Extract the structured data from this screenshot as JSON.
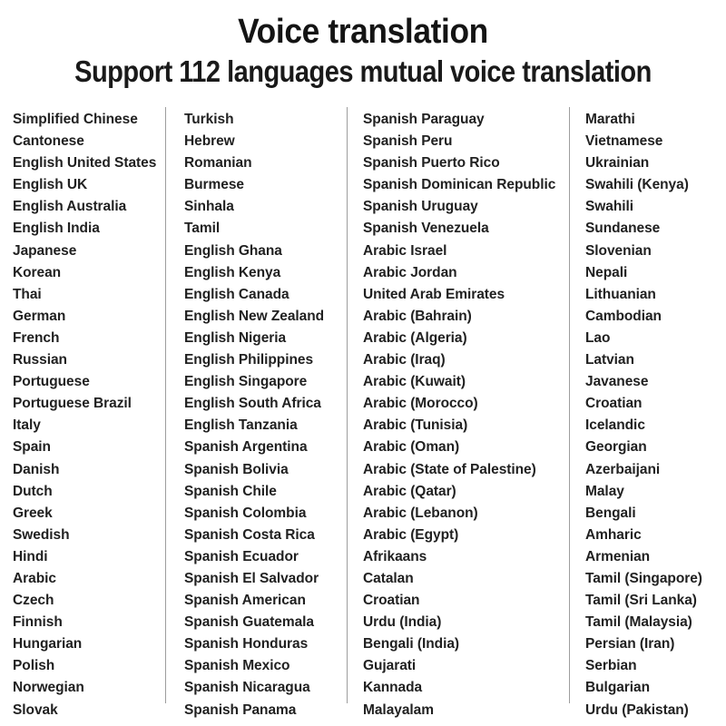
{
  "header": {
    "title": "Voice translation",
    "subtitle": "Support 112 languages mutual voice translation"
  },
  "columns": [
    {
      "index": 0,
      "items": [
        "Simplified Chinese",
        "Cantonese",
        "English United States",
        "English UK",
        "English Australia",
        "English India",
        "Japanese",
        "Korean",
        "Thai",
        "German",
        "French",
        "Russian",
        "Portuguese",
        "Portuguese Brazil",
        "Italy",
        "Spain",
        "Danish",
        "Dutch",
        "Greek",
        "Swedish",
        "Hindi",
        "Arabic",
        "Czech",
        "Finnish",
        "Hungarian",
        "Polish",
        "Norwegian",
        "Slovak"
      ]
    },
    {
      "index": 1,
      "items": [
        "Turkish",
        "Hebrew",
        "Romanian",
        "Burmese",
        "Sinhala",
        "Tamil",
        "English Ghana",
        "English Kenya",
        "English Canada",
        "English New Zealand",
        "English Nigeria",
        "English Philippines",
        "English Singapore",
        "English South Africa",
        "English Tanzania",
        "Spanish Argentina",
        "Spanish Bolivia",
        "Spanish Chile",
        "Spanish Colombia",
        "Spanish Costa Rica",
        "Spanish Ecuador",
        "Spanish El Salvador",
        "Spanish American",
        "Spanish Guatemala",
        "Spanish Honduras",
        "Spanish Mexico",
        "Spanish Nicaragua",
        "Spanish Panama"
      ]
    },
    {
      "index": 2,
      "items": [
        "Spanish Paraguay",
        "Spanish Peru",
        "Spanish Puerto Rico",
        "Spanish Dominican Republic",
        "Spanish Uruguay",
        "Spanish Venezuela",
        "Arabic Israel",
        "Arabic Jordan",
        "United Arab Emirates",
        "Arabic (Bahrain)",
        "Arabic (Algeria)",
        "Arabic (Iraq)",
        "Arabic (Kuwait)",
        "Arabic (Morocco)",
        "Arabic (Tunisia)",
        "Arabic (Oman)",
        "Arabic (State of Palestine)",
        "Arabic (Qatar)",
        "Arabic (Lebanon)",
        "Arabic (Egypt)",
        "Afrikaans",
        "Catalan",
        "Croatian",
        "Urdu (India)",
        "Bengali (India)",
        "Gujarati",
        "Kannada",
        "Malayalam"
      ]
    },
    {
      "index": 3,
      "items": [
        "Marathi",
        "Vietnamese",
        "Ukrainian",
        "Swahili (Kenya)",
        "Swahili",
        "Sundanese",
        "Slovenian",
        "Nepali",
        "Lithuanian",
        "Cambodian",
        "Lao",
        "Latvian",
        "Javanese",
        "Croatian",
        "Icelandic",
        "Georgian",
        "Azerbaijani",
        "Malay",
        "Bengali",
        "Amharic",
        "Armenian",
        "Tamil (Singapore)",
        "Tamil (Sri Lanka)",
        "Tamil (Malaysia)",
        "Persian (Iran)",
        "Serbian",
        "Bulgarian",
        "Urdu (Pakistan)"
      ]
    }
  ],
  "colors": {
    "background": "#ffffff",
    "text": "#212121",
    "title": "#141414",
    "divider": "#9d9d9d"
  }
}
